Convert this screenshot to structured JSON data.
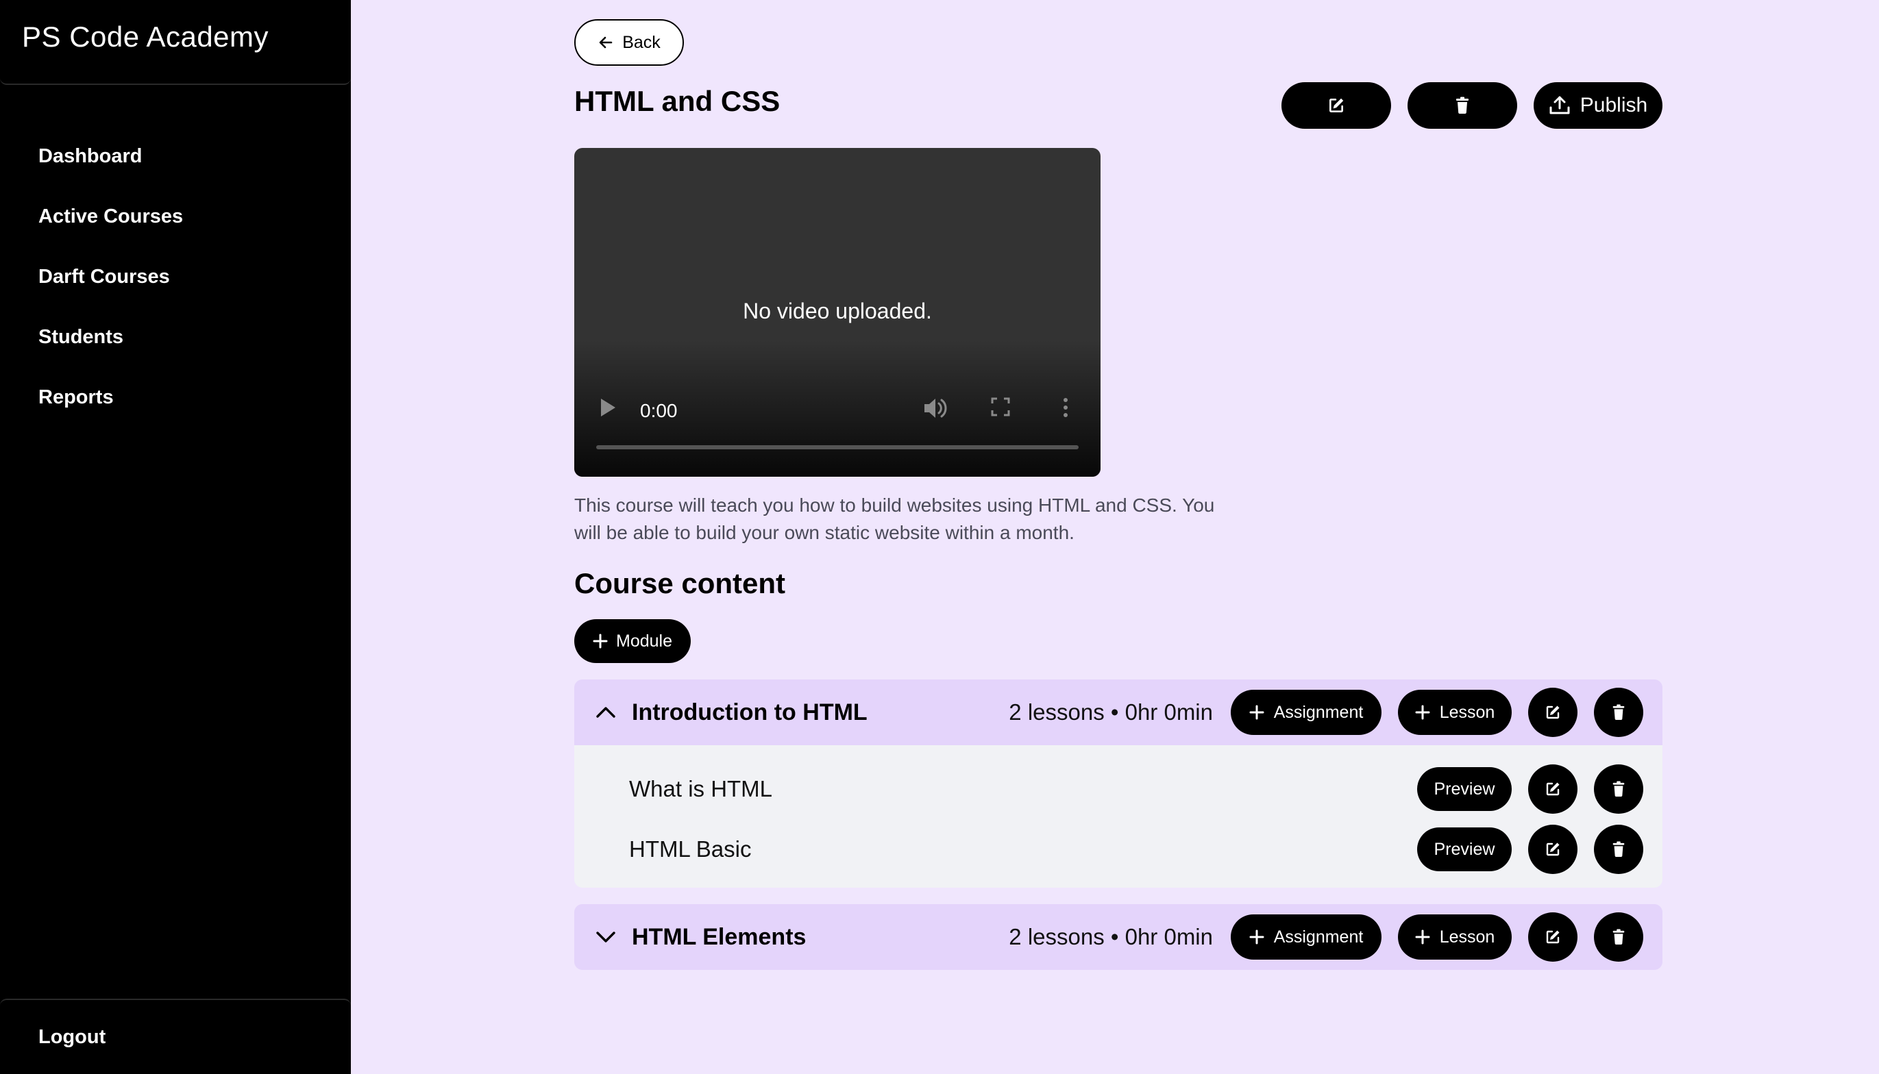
{
  "app": {
    "title": "PS Code Academy"
  },
  "sidebar": {
    "items": [
      {
        "label": "Dashboard"
      },
      {
        "label": "Active Courses"
      },
      {
        "label": "Darft Courses"
      },
      {
        "label": "Students"
      },
      {
        "label": "Reports"
      }
    ],
    "logout_label": "Logout"
  },
  "course": {
    "back_label": "Back",
    "title": "HTML and CSS",
    "publish_label": "Publish",
    "video": {
      "message": "No video uploaded.",
      "time": "0:00",
      "progress": 0
    },
    "description": "This course will teach you how to build websites using HTML and CSS. You will be able to build your own static website within a month.",
    "content_heading": "Course content",
    "add_module_label": "Module"
  },
  "modules": [
    {
      "title": "Introduction to HTML",
      "meta": "2 lessons • 0hr 0min",
      "expanded": true,
      "assignment_label": "Assignment",
      "lesson_label": "Lesson",
      "lessons": [
        {
          "name": "What is HTML",
          "preview_label": "Preview"
        },
        {
          "name": "HTML Basic",
          "preview_label": "Preview"
        }
      ]
    },
    {
      "title": "HTML Elements",
      "meta": "2 lessons • 0hr 0min",
      "expanded": false,
      "assignment_label": "Assignment",
      "lesson_label": "Lesson"
    }
  ],
  "colors": {
    "page_bg": "#f0e6fd",
    "sidebar_bg": "#000000",
    "module_header_bg": "#e4d4fb",
    "lesson_bg": "#f1f2f5",
    "button_bg": "#000000"
  }
}
